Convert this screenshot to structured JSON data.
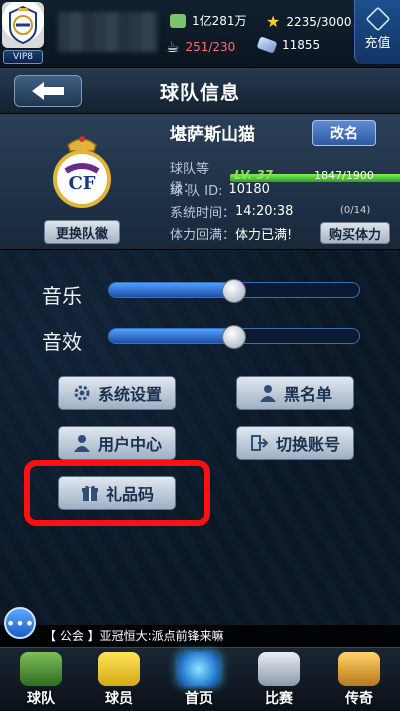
{
  "topbar": {
    "vip_label": "VIP8",
    "money": "1亿281万",
    "stars": "2235/3000",
    "coffee": "251/230",
    "gems": "11855",
    "recharge_label": "充值"
  },
  "header": {
    "title": "球队信息"
  },
  "team": {
    "name": "堪萨斯山猫",
    "rename_label": "改名",
    "change_crest_label": "更换队徽",
    "level_label": "球队等级：",
    "level_value": "LV. 37",
    "exp": "1847/1900",
    "exp_fraction": 0.972,
    "id_label": "球 队 ID:",
    "id_value": "10180",
    "time_label": "系统时间：",
    "time_value": "14:20:38",
    "energy_count": "(0/14)",
    "energy_label": "体力回满：",
    "energy_value": "体力已满!",
    "buy_energy_label": "购买体力"
  },
  "settings": {
    "music_label": "音乐",
    "music_level": 0.5,
    "sfx_label": "音效",
    "sfx_level": 0.5
  },
  "menu": {
    "system_settings": "系统设置",
    "blacklist": "黑名单",
    "user_center": "用户中心",
    "switch_account": "切换账号",
    "gift_code": "礼品码"
  },
  "chat": {
    "message": "【 公会 】亚冠恒大:派点前锋来嘛"
  },
  "nav": [
    {
      "label": "球队"
    },
    {
      "label": "球员"
    },
    {
      "label": "首页"
    },
    {
      "label": "比赛"
    },
    {
      "label": "传奇"
    }
  ],
  "colors": {
    "accent": "#2f7fd6",
    "highlight": "#ff1010",
    "level_green": "#8fe35c",
    "coffee_red": "#ff6b6b"
  }
}
